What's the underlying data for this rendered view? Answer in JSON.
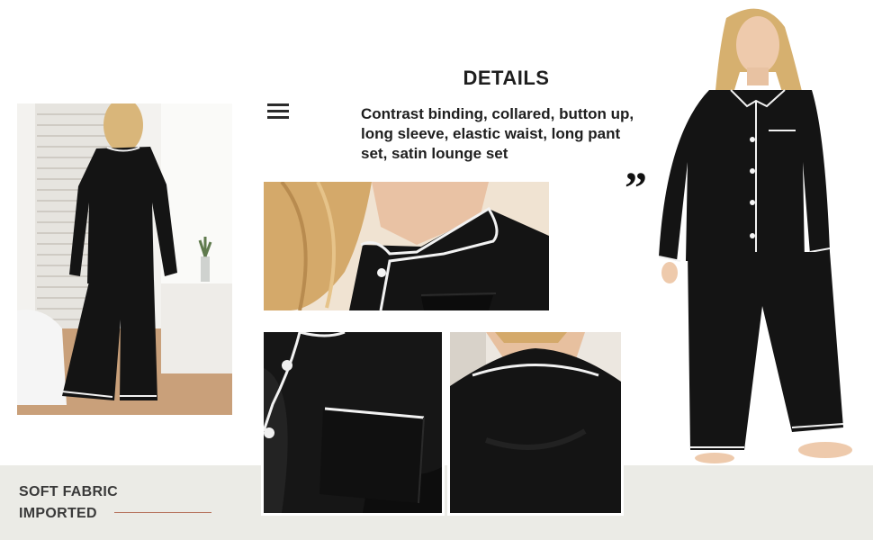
{
  "details": {
    "title": "DETAILS",
    "description": "Contrast binding, collared, button up, long sleeve, elastic waist, long pant set, satin lounge set"
  },
  "features": {
    "line1": "SOFT FABRIC",
    "line2": "IMPORTED"
  },
  "quote_mark": "”",
  "icons": {
    "menu": "menu-icon",
    "quote": "closing-quote-icon"
  },
  "images": [
    {
      "name": "back-view-photo",
      "subject": "model wearing black satin pajama set, back view"
    },
    {
      "name": "collar-closeup-photo",
      "subject": "close-up of notched collar with white piping"
    },
    {
      "name": "pocket-closeup-photo",
      "subject": "close-up of chest pocket with white piping"
    },
    {
      "name": "back-collar-closeup-photo",
      "subject": "close-up of back collar"
    },
    {
      "name": "front-view-photo",
      "subject": "model wearing black satin pajama set, front view"
    }
  ],
  "colors": {
    "band": "#ebebe6",
    "accent_line": "#b5705a",
    "fabric": "#141414",
    "piping": "#f2f2f2",
    "text": "#1e1e1e"
  }
}
